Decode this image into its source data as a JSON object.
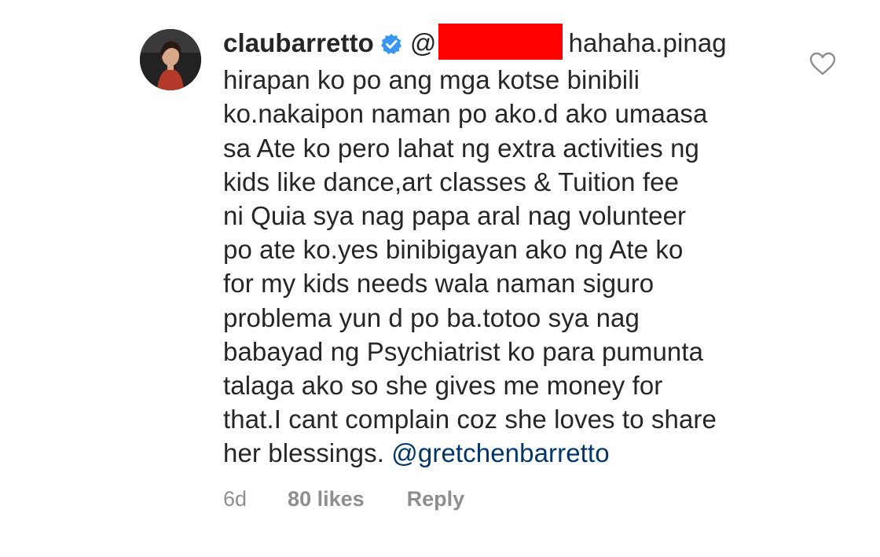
{
  "comment": {
    "username": "claubarretto",
    "verified": true,
    "mention_prefix": "@",
    "lines": [
      "hahaha.pinag",
      "hirapan ko po ang mga kotse binibili",
      "ko.nakaipon naman po ako.d ako umaasa",
      "sa Ate ko pero lahat ng extra activities ng",
      "kids like dance,art classes & Tuition fee",
      "ni Quia sya nag papa aral nag volunteer",
      "po ate ko.yes binibigayan ako ng Ate ko",
      "for my kids needs wala naman siguro",
      "problema yun d po ba.totoo sya nag",
      "babayad ng Psychiatrist ko para pumunta",
      "talaga ako so she gives me money for",
      "that.I cant complain coz she loves to share",
      "her blessings."
    ],
    "tagged_user": "@gretchenbarretto",
    "time_ago": "6d",
    "likes": "80 likes",
    "reply_label": "Reply"
  },
  "colors": {
    "redaction": "#ff0000",
    "verified_badge": "#3897f0",
    "mention_link": "#00376b",
    "meta_text": "#8e8e8e"
  },
  "icons": {
    "verified": "verified-badge-icon",
    "like": "heart-outline-icon"
  }
}
